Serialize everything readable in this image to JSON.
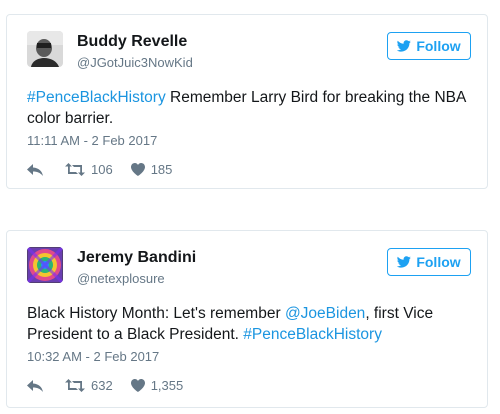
{
  "tweets": [
    {
      "name": "Buddy Revelle",
      "handle": "@JGotJuic3NowKid",
      "follow_label": "Follow",
      "text_parts": [
        {
          "text": "#PenceBlackHistory",
          "link": true
        },
        {
          "text": " Remember Larry Bird for breaking the NBA color barrier.",
          "link": false
        }
      ],
      "timestamp": "11:11 AM - 2 Feb 2017",
      "retweets": "106",
      "likes": "185"
    },
    {
      "name": "Jeremy Bandini",
      "handle": "@netexplosure",
      "follow_label": "Follow",
      "text_parts": [
        {
          "text": "Black History Month: Let's remember ",
          "link": false
        },
        {
          "text": "@JoeBiden",
          "link": true
        },
        {
          "text": ", first Vice President to a Black President. ",
          "link": false
        },
        {
          "text": "#PenceBlackHistory",
          "link": true
        }
      ],
      "timestamp": "10:32 AM - 2 Feb 2017",
      "retweets": "632",
      "likes": "1,355"
    }
  ],
  "colors": {
    "accent": "#1da1f2",
    "link": "#1b95e0",
    "muted": "#657786",
    "border": "#e1e8ed"
  },
  "icons": {
    "follow": "twitter-bird-icon",
    "reply": "reply-arrow-icon",
    "retweet": "retweet-icon",
    "like": "heart-icon"
  }
}
